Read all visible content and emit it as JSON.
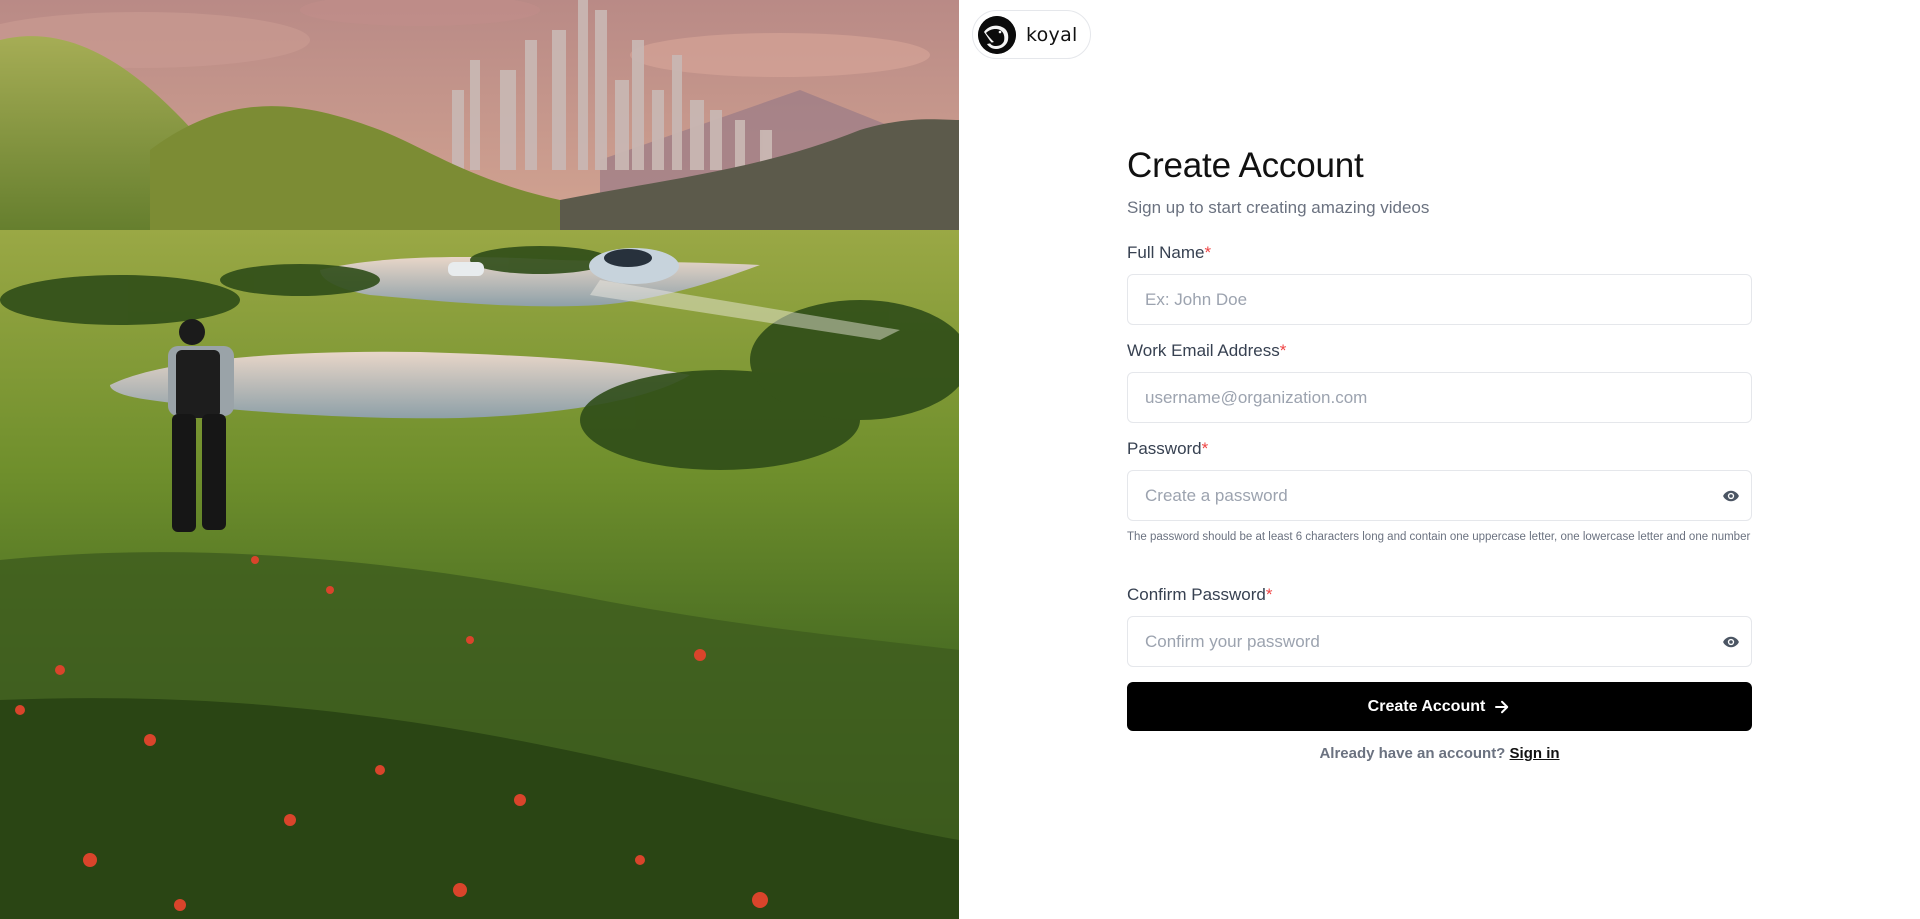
{
  "brand": {
    "name": "koyal"
  },
  "hero": {
    "image": "futuristic landscape illustration with city, lakes, flying vehicle and man on meadow"
  },
  "form": {
    "title": "Create Account",
    "subtitle": "Sign up to start creating amazing videos",
    "fields": [
      {
        "label": "Full Name",
        "required_mark": "*",
        "placeholder": "Ex: John Doe",
        "value": ""
      },
      {
        "label": "Work Email Address",
        "required_mark": "*",
        "placeholder": "username@organization.com",
        "value": ""
      },
      {
        "label": "Password",
        "required_mark": "*",
        "placeholder": "Create a password",
        "value": "",
        "icon": "eye-icon",
        "hint": "The password should be at least 6 characters long and contain one uppercase letter, one lowercase letter and one number"
      },
      {
        "label": "Confirm Password",
        "required_mark": "*",
        "placeholder": "Confirm your password",
        "value": "",
        "icon": "eye-icon"
      }
    ],
    "submit_label": "Create Account",
    "submit_icon": "arrow-right-icon",
    "signin_prompt": "Already have an account?",
    "signin_link": "Sign in"
  },
  "colors": {
    "accent": "#000000",
    "required": "#ef4444",
    "muted": "#6b7280",
    "border": "#e5e7eb"
  }
}
